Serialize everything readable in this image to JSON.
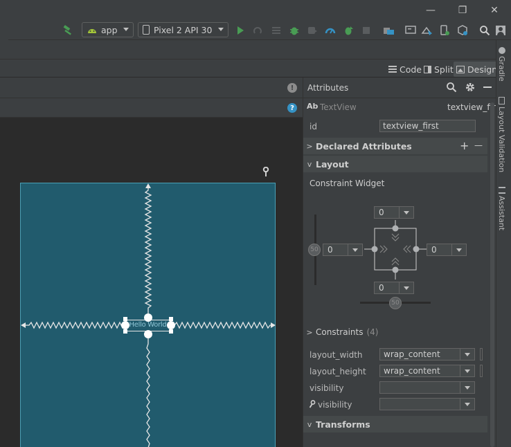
{
  "window": {
    "minimize": "—",
    "maximize": "❐",
    "close": "✕"
  },
  "toolbar": {
    "app_config": "app",
    "device": "Pixel 2 API 30",
    "icons": [
      "hammer-icon",
      "android-icon",
      "device-icon",
      "run-icon",
      "apply-changes-icon",
      "apply-code-icon",
      "debug-icon",
      "attach-debugger-icon",
      "profile-icon",
      "coverage-icon",
      "stop-icon",
      "sync-icon",
      "avd-manager-icon",
      "sdk-manager-icon",
      "device-manager-icon",
      "layout-inspector-icon",
      "search-icon",
      "account-icon"
    ]
  },
  "modes": {
    "code": "Code",
    "split": "Split",
    "design": "Design"
  },
  "design": {
    "warning": "!",
    "help": "?"
  },
  "canvas": {
    "textview_text": "Hello World"
  },
  "attributes": {
    "title": "Attributes",
    "widget_icon": "Ab",
    "widget_type": "TextView",
    "widget_id": "textview_first",
    "id_label": "id",
    "id_value": "textview_first",
    "declared_attributes": "Declared Attributes",
    "layout": "Layout",
    "constraint_widget": "Constraint Widget",
    "margin_top": "0",
    "margin_left": "0",
    "margin_right": "0",
    "margin_bottom": "0",
    "bias_vertical": "50",
    "bias_horizontal": "50",
    "constraints": "Constraints",
    "constraints_count": "(4)",
    "layout_width_label": "layout_width",
    "layout_width_value": "wrap_content",
    "layout_height_label": "layout_height",
    "layout_height_value": "wrap_content",
    "visibility_label": "visibility",
    "visibility_value": "",
    "tools_visibility_label": "visibility",
    "tools_visibility_value": "",
    "transforms": "Transforms",
    "add": "+",
    "remove": "—"
  },
  "side_tabs": {
    "gradle": "Gradle",
    "layout_validation": "Layout Validation",
    "assistant": "Assistant"
  },
  "colors": {
    "canvas_blue": "#215b6d",
    "accent_green": "#499c54",
    "blueprint_line": "#e6e6e6"
  }
}
